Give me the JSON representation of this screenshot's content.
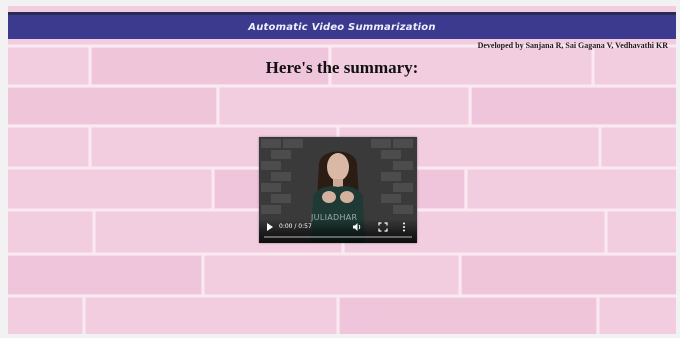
{
  "header": {
    "title": "Automatic Video Summarization"
  },
  "credits": "Developed by Sanjana R, Sai Gagana V, Vedhavathi KR",
  "main": {
    "heading": "Here's the summary:"
  },
  "video": {
    "time": "0:00 / 0:57",
    "watermark": "JULIADHAR",
    "progress": 0.0,
    "icons": {
      "play": "play-icon",
      "volume": "volume-icon",
      "fullscreen": "fullscreen-icon",
      "more": "more-vert-icon"
    }
  },
  "colors": {
    "header_bg": "#3b3a8f",
    "wall": "#f3cfe0"
  }
}
